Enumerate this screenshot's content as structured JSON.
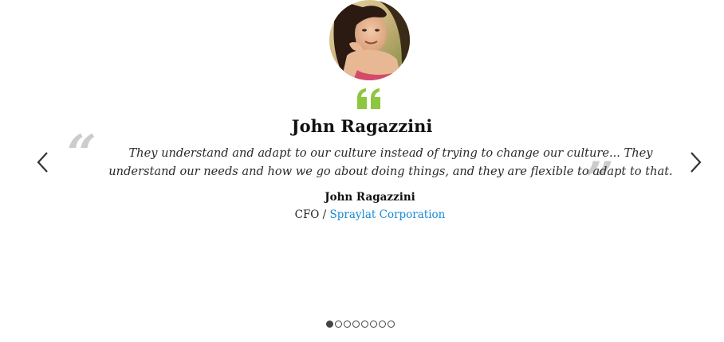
{
  "testimonial": {
    "heading": "John Ragazzini",
    "quote": "They understand and adapt to our culture instead of trying to change our culture... They understand our needs and how we go about doing things, and they are flexible to adapt to that.",
    "open_quote_glyph": "“",
    "close_quote_glyph": "”",
    "author_name": "John Ragazzini",
    "author_role": "CFO",
    "role_separator": " / ",
    "company": "Spraylat Corporation"
  },
  "carousel": {
    "prev_icon": "chevron-left-icon",
    "next_icon": "chevron-right-icon",
    "dot_count": 8,
    "active_index": 0
  },
  "colors": {
    "accent_green": "#8dc63f",
    "link_blue": "#1a8ad0",
    "quote_gray": "#cccccc"
  }
}
